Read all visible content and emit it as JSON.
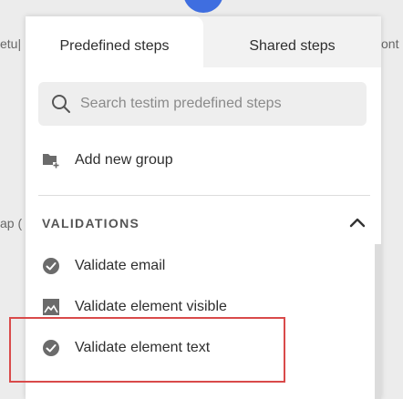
{
  "background": {
    "left_texts": [
      "etu|",
      "ap ("
    ],
    "right_texts": [
      "ont"
    ]
  },
  "tabs": [
    {
      "label": "Predefined steps",
      "active": true
    },
    {
      "label": "Shared steps",
      "active": false
    }
  ],
  "search": {
    "placeholder": "Search testim predefined steps",
    "value": ""
  },
  "actions": {
    "add_group_label": "Add new group"
  },
  "validations": {
    "title": "VALIDATIONS",
    "items": [
      {
        "label": "Validate email",
        "icon": "check-circle-icon"
      },
      {
        "label": "Validate element visible",
        "icon": "image-icon"
      },
      {
        "label": "Validate element text",
        "icon": "check-circle-icon",
        "highlighted": true
      }
    ]
  },
  "colors": {
    "accent_blue": "#3f6ee0",
    "highlight_red": "#d94a4a",
    "icon_gray": "#6b6b6b"
  }
}
